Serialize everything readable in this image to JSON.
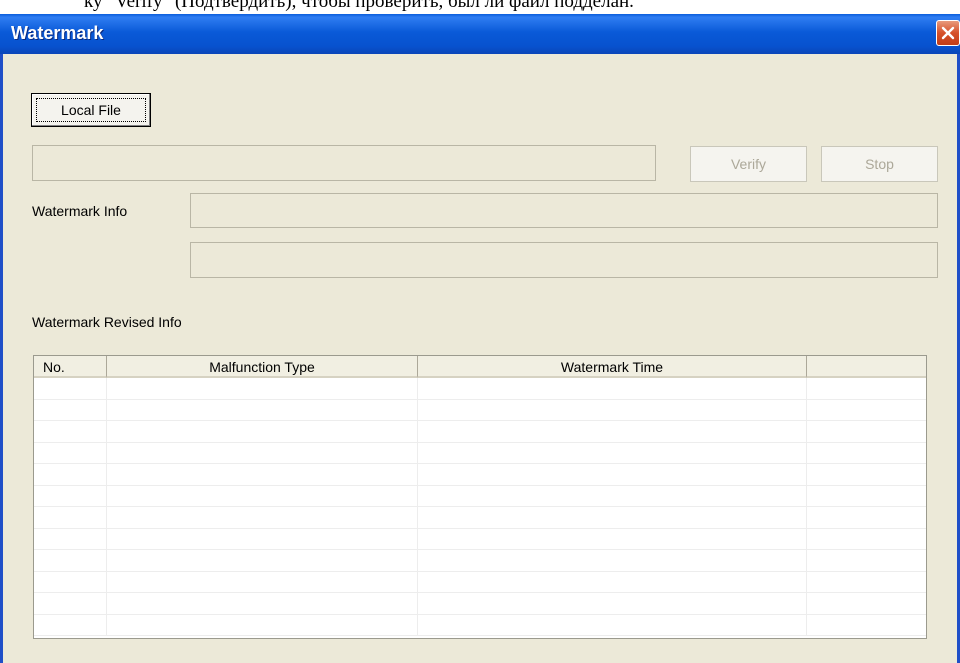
{
  "document_strip": {
    "text": "ку \"Verify\" (Подтвердить), чтобы проверить, был ли файл подделан."
  },
  "window": {
    "title": "Watermark"
  },
  "buttons": {
    "local_file": "Local File",
    "verify": "Verify",
    "stop": "Stop"
  },
  "fields": {
    "file_path": "",
    "watermark_info_1": "",
    "watermark_info_2": ""
  },
  "labels": {
    "watermark_info": "Watermark Info",
    "watermark_revised_info": "Watermark Revised Info"
  },
  "table": {
    "columns": [
      "No.",
      "Malfunction Type",
      "Watermark Time",
      ""
    ],
    "rows": [
      [
        "",
        "",
        "",
        ""
      ],
      [
        "",
        "",
        "",
        ""
      ],
      [
        "",
        "",
        "",
        ""
      ],
      [
        "",
        "",
        "",
        ""
      ],
      [
        "",
        "",
        "",
        ""
      ],
      [
        "",
        "",
        "",
        ""
      ],
      [
        "",
        "",
        "",
        ""
      ],
      [
        "",
        "",
        "",
        ""
      ],
      [
        "",
        "",
        "",
        ""
      ],
      [
        "",
        "",
        "",
        ""
      ],
      [
        "",
        "",
        "",
        ""
      ],
      [
        "",
        "",
        "",
        ""
      ]
    ]
  },
  "colors": {
    "titlebar": "#0a5ad8",
    "dialog_background": "#ece9d8",
    "close_button": "#d6512a"
  }
}
